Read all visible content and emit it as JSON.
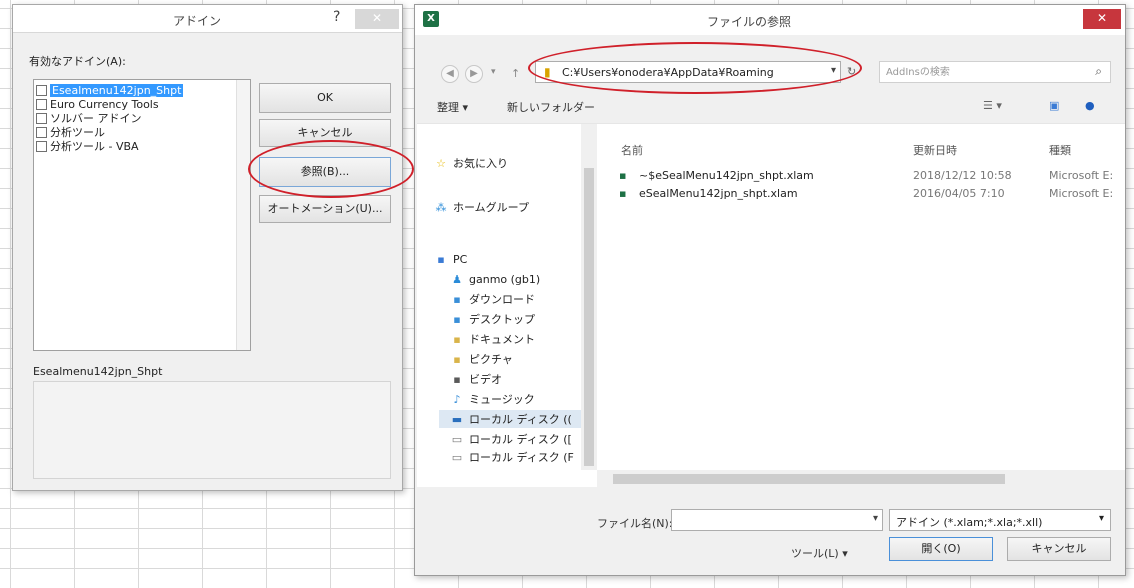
{
  "addin_dialog": {
    "title": "アドイン",
    "help": "?",
    "close": "✕",
    "available_label": "有効なアドイン(A):",
    "items": [
      {
        "label": "Esealmenu142jpn_Shpt",
        "selected": true
      },
      {
        "label": "Euro Currency Tools",
        "selected": false
      },
      {
        "label": "ソルバー アドイン",
        "selected": false
      },
      {
        "label": "分析ツール",
        "selected": false
      },
      {
        "label": "分析ツール - VBA",
        "selected": false
      }
    ],
    "ok_label": "OK",
    "cancel_label": "キャンセル",
    "browse_label": "参照(B)...",
    "automation_label": "オートメーション(U)...",
    "selected_name": "Esealmenu142jpn_Shpt"
  },
  "file_dialog": {
    "title": "ファイルの参照",
    "app_icon": "X",
    "close": "✕",
    "path": "C:¥Users¥onodera¥AppData¥Roaming",
    "search_placeholder": "AddInsの検索",
    "toolbar": {
      "organize": "整理 ▾",
      "new_folder": "新しいフォルダー"
    },
    "nav_items": [
      {
        "icon": "☆",
        "label": "お気に入り"
      },
      {
        "icon": "⁂",
        "label": "ホームグループ"
      },
      {
        "icon": "▪",
        "label": "PC"
      },
      {
        "icon": "♟",
        "label": "ganmo (gb1)"
      },
      {
        "icon": "▪",
        "label": "ダウンロード"
      },
      {
        "icon": "▪",
        "label": "デスクトップ"
      },
      {
        "icon": "▪",
        "label": "ドキュメント"
      },
      {
        "icon": "▪",
        "label": "ピクチャ"
      },
      {
        "icon": "▪",
        "label": "ビデオ"
      },
      {
        "icon": "♪",
        "label": "ミュージック"
      },
      {
        "icon": "▬",
        "label": "ローカル ディスク (("
      },
      {
        "icon": "▭",
        "label": "ローカル ディスク (["
      },
      {
        "icon": "▭",
        "label": "ローカル ディスク (F"
      }
    ],
    "columns": {
      "name": "名前",
      "date": "更新日時",
      "type": "種類"
    },
    "files": [
      {
        "name": "~$eSealMenu142jpn_shpt.xlam",
        "date": "2018/12/12 10:58",
        "type": "Microsoft E:"
      },
      {
        "name": "eSealMenu142jpn_shpt.xlam",
        "date": "2016/04/05 7:10",
        "type": "Microsoft E:"
      }
    ],
    "filename_label": "ファイル名(N):",
    "filename_value": "",
    "filter": "アドイン (*.xlam;*.xla;*.xll)",
    "tools_label": "ツール(L) ▾",
    "open_label": "開く(O)",
    "cancel_label": "キャンセル"
  }
}
